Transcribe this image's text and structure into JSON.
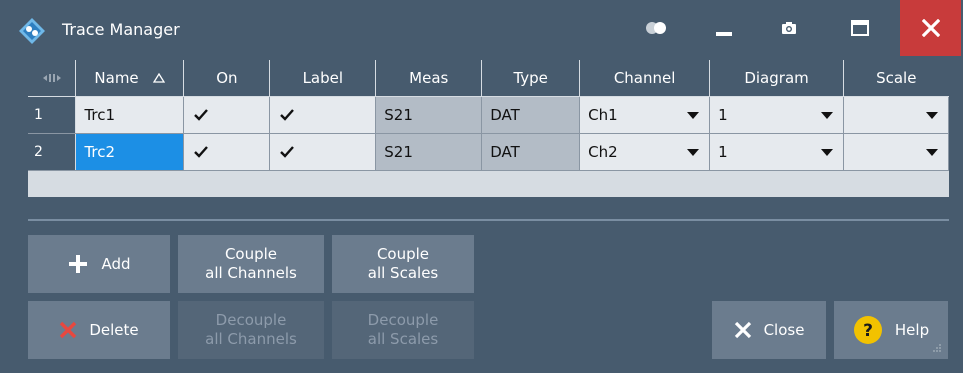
{
  "window": {
    "title": "Trace Manager",
    "accent_close": "#c83b3b",
    "background": "#475b6e"
  },
  "titlebar": {
    "icons": [
      "app-logo-icon",
      "toggle-icon",
      "minimize-icon",
      "camera-icon",
      "maximize-icon",
      "close-icon"
    ]
  },
  "table": {
    "columns": [
      "",
      "Name",
      "On",
      "Label",
      "Meas",
      "Type",
      "Channel",
      "Diagram",
      "Scale"
    ],
    "rows": [
      {
        "num": "1",
        "name": "Trc1",
        "on": true,
        "label": true,
        "meas": "S21",
        "type": "DAT",
        "channel": "Ch1",
        "diagram": "1",
        "scale": ""
      },
      {
        "num": "2",
        "name": "Trc2",
        "on": true,
        "label": true,
        "meas": "S21",
        "type": "DAT",
        "channel": "Ch2",
        "diagram": "1",
        "scale": ""
      }
    ],
    "selected_cell_color": "#1c8fe5"
  },
  "buttons": {
    "add": "Add",
    "couple_channels_1": "Couple",
    "couple_channels_2": "all Channels",
    "couple_scales_1": "Couple",
    "couple_scales_2": "all Scales",
    "delete": "Delete",
    "decouple_channels_1": "Decouple",
    "decouple_channels_2": "all Channels",
    "decouple_scales_1": "Decouple",
    "decouple_scales_2": "all Scales",
    "close": "Close",
    "help": "Help"
  }
}
